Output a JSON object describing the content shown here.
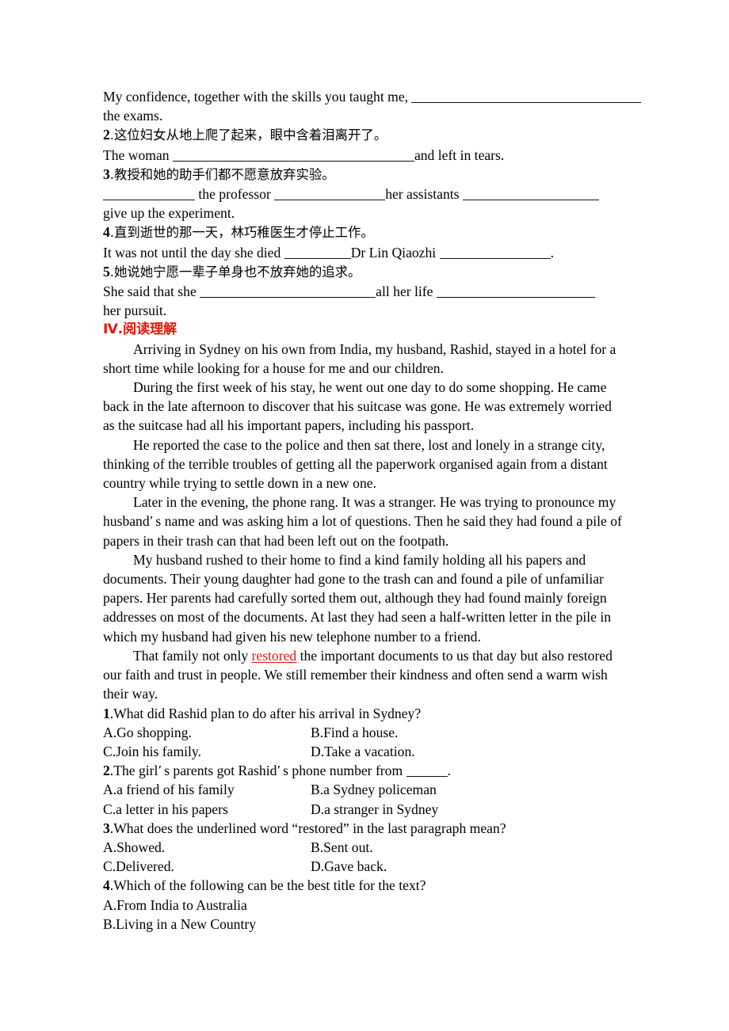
{
  "document": {
    "translation_exercise": {
      "item1": {
        "english_part1": "My confidence, together with the skills you taught me,",
        "blank1_width": 290,
        "english_part2": "the exams."
      },
      "item2": {
        "number": "2",
        "chinese": ".这位妇女从地上爬了起来，眼中含着泪离开了。",
        "english_part1": "The woman",
        "blank1_width": 305,
        "english_part2": "and left in tears."
      },
      "item3": {
        "number": "3",
        "chinese": ".教授和她的助手们都不愿意放弃实验。",
        "blank1_width": 116,
        "english_part1": "the professor",
        "blank2_width": 140,
        "english_part2": "her assistants",
        "blank3_width": 172,
        "english_part3": "give up the experiment."
      },
      "item4": {
        "number": "4",
        "chinese": ".直到逝世的那一天，林巧稚医生才停止工作。",
        "english_part1": "It was not until the day she died",
        "blank1_width": 84,
        "english_part2": "Dr Lin Qiaozhi",
        "blank2_width": 140,
        "english_part3": "."
      },
      "item5": {
        "number": "5",
        "chinese": ".她说她宁愿一辈子单身也不放弃她的追求。",
        "english_part1": "She said that she",
        "blank1_width": 222,
        "english_part2": "all her life",
        "blank2_width": 200,
        "english_part3": "her pursuit."
      }
    },
    "section_heading": "Ⅳ.阅读理解",
    "passage": {
      "paragraphs": [
        "Arriving in Sydney on his own from India, my husband, Rashid, stayed in a hotel for a short time while looking for a house for me and our children.",
        "During the first week of his stay, he went out one day to do some shopping. He came back in the late afternoon to discover that his suitcase was gone. He was extremely worried as the suitcase had all his important papers, including his passport.",
        "He reported the case to the police and then sat there, lost and lonely in a strange city, thinking of the terrible troubles of getting all the paperwork organised again from a distant country while trying to settle down in a new one.",
        "My husband rushed to their home to find a kind family holding all his papers and documents. Their young daughter had gone to the trash can and found a pile of unfamiliar papers. Her parents had carefully sorted them out, although they had found mainly foreign addresses on most of the documents. At last they had seen a half-written letter in the pile in which my husband had given his new telephone number to a friend."
      ],
      "paragraph_phone": {
        "part1": "Later in the evening, the phone rang. It was a stranger. He was trying to pronounce my husband",
        "apostrophe": "’",
        "part2": "s name and was asking him a lot of questions. Then he said they had found a pile of papers in their trash can that had been left out on the footpath."
      },
      "paragraph_last": {
        "part1": "That family not only ",
        "highlighted_word": "restored",
        "part2": " the important documents to us that day but also restored our faith and trust in people. We still remember their kindness and often send a warm wish their way."
      }
    },
    "questions": [
      {
        "number": "1",
        "stem": ".What did Rashid plan to do after his arrival in Sydney?",
        "options": [
          "A.Go shopping.",
          "B.Find a house.",
          "C.Join his family.",
          "D.Take a vacation."
        ]
      },
      {
        "number": "2",
        "stem_part1": ".The girl",
        "apostrophe": "’",
        "stem_part2": "s parents got Rashid",
        "stem_part3": "s phone number from",
        "blank_width": 52,
        "stem_part4": ".",
        "options": [
          "A.a friend of his family",
          "B.a Sydney policeman",
          "C.a letter in his papers",
          "D.a stranger in Sydney"
        ]
      },
      {
        "number": "3",
        "stem": ".What does the underlined word “restored” in the last paragraph mean?",
        "options": [
          "A.Showed.",
          "B.Sent out.",
          "C.Delivered.",
          "D.Gave back."
        ]
      },
      {
        "number": "4",
        "stem": ".Which of the following can be the best title for the text?",
        "options": [
          "A.From India to Australia",
          "B.Living in a New Country"
        ]
      }
    ]
  },
  "colors": {
    "heading_red": "#e8170f",
    "text_black": "#000000",
    "page_background": "#ffffff"
  }
}
